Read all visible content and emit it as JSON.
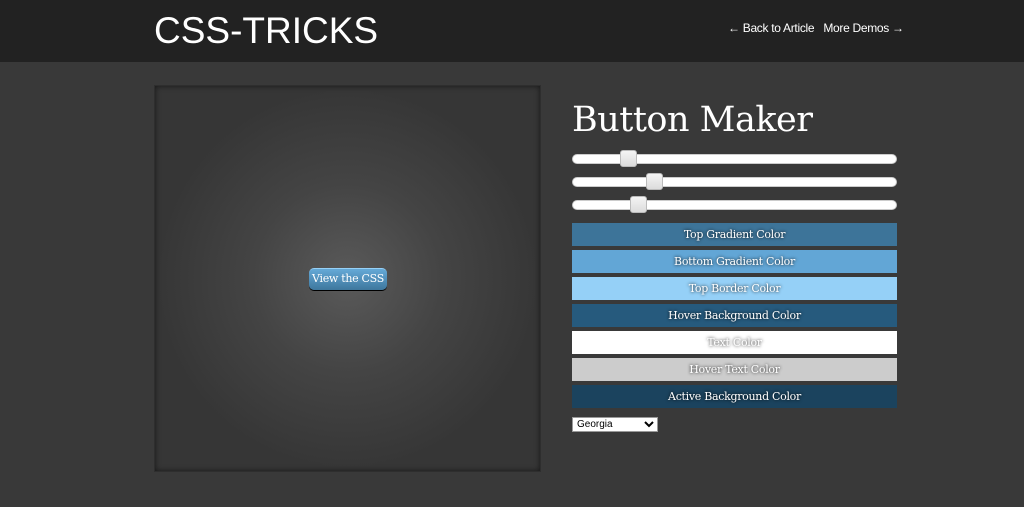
{
  "header": {
    "logo": "CSS-TRICKS",
    "back_link": "← Back to Article",
    "more_link": "More Demos →"
  },
  "preview": {
    "button_label": "View the CSS"
  },
  "panel": {
    "title": "Button Maker",
    "sliders": [
      {
        "value": 0.17
      },
      {
        "value": 0.25
      },
      {
        "value": 0.2
      }
    ],
    "color_buttons": [
      {
        "label": "Top Gradient Color",
        "color": "#3d7499"
      },
      {
        "label": "Bottom Gradient Color",
        "color": "#62a6d6"
      },
      {
        "label": "Top Border Color",
        "color": "#95d0f7"
      },
      {
        "label": "Hover Background Color",
        "color": "#265a7d"
      },
      {
        "label": "Text Color",
        "color": "#ffffff"
      },
      {
        "label": "Hover Text Color",
        "color": "#cccccc"
      },
      {
        "label": "Active Background Color",
        "color": "#1b435e"
      }
    ],
    "font_select": "Georgia"
  }
}
